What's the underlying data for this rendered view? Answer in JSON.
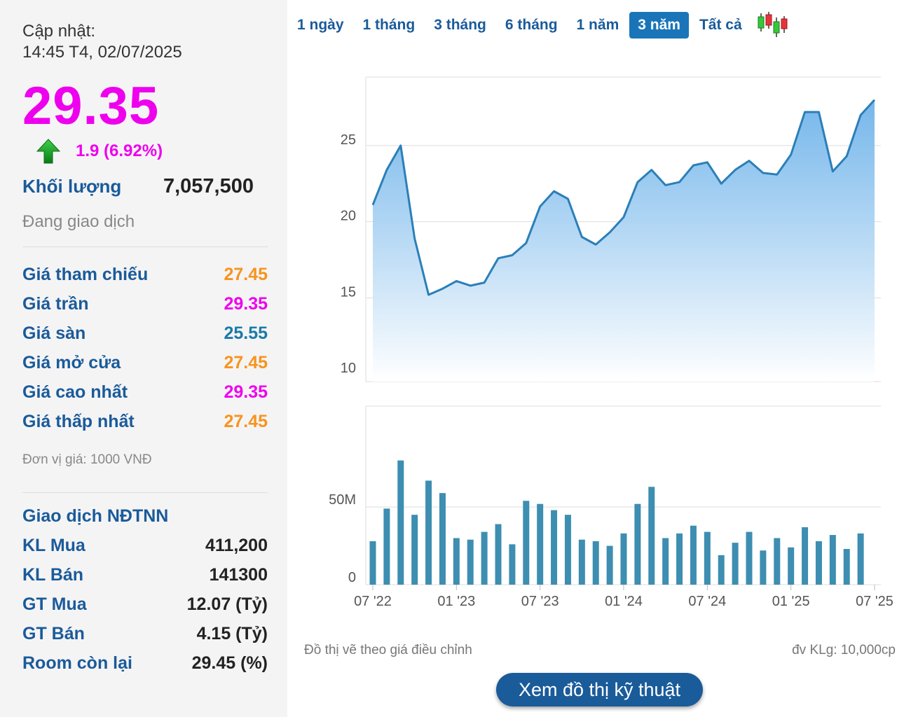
{
  "quote": {
    "update_label": "Cập nhật:",
    "update_time": "14:45 T4, 02/07/2025",
    "price": "29.35",
    "change": "1.9 (6.92%)",
    "volume_label": "Khối lượng",
    "volume_value": "7,057,500",
    "status": "Đang giao dịch",
    "unit_note": "Đơn vị giá: 1000 VNĐ"
  },
  "price_rows": [
    {
      "label": "Giá tham chiếu",
      "value": "27.45",
      "color": "#f7941d"
    },
    {
      "label": "Giá trần",
      "value": "29.35",
      "color": "#ee00ee"
    },
    {
      "label": "Giá sàn",
      "value": "25.55",
      "color": "#1a7aa8"
    },
    {
      "label": "Giá mở cửa",
      "value": "27.45",
      "color": "#f7941d"
    },
    {
      "label": "Giá cao nhất",
      "value": "29.35",
      "color": "#ee00ee"
    },
    {
      "label": "Giá thấp nhất",
      "value": "27.45",
      "color": "#f7941d"
    }
  ],
  "foreign": {
    "title": "Giao dịch NĐTNN",
    "rows": [
      {
        "label": "KL Mua",
        "value": "411,200"
      },
      {
        "label": "KL Bán",
        "value": "141300"
      },
      {
        "label": "GT Mua",
        "value": "12.07 (Tỷ)"
      },
      {
        "label": "GT Bán",
        "value": "4.15 (Tỷ)"
      },
      {
        "label": "Room còn lại",
        "value": "29.45 (%)"
      }
    ]
  },
  "tabs": [
    {
      "label": "1 ngày",
      "active": false
    },
    {
      "label": "1 tháng",
      "active": false
    },
    {
      "label": "3 tháng",
      "active": false
    },
    {
      "label": "6 tháng",
      "active": false
    },
    {
      "label": "1 năm",
      "active": false
    },
    {
      "label": "3 năm",
      "active": true
    },
    {
      "label": "Tất cả",
      "active": false
    }
  ],
  "chart_data": {
    "type": "area",
    "price_axis": {
      "ylim": [
        9.5,
        29.5
      ],
      "ticks": [
        "25",
        "20",
        "15",
        "10"
      ],
      "tick_values": [
        25,
        20,
        15,
        10
      ]
    },
    "volume_axis": {
      "ylim": [
        0,
        115
      ],
      "ticks": [
        "50M",
        "0"
      ],
      "tick_values": [
        50,
        0
      ]
    },
    "x_ticks": [
      {
        "label": "07 '22",
        "x": 0
      },
      {
        "label": "01 '23",
        "x": 6
      },
      {
        "label": "07 '23",
        "x": 12
      },
      {
        "label": "01 '24",
        "x": 18
      },
      {
        "label": "07 '24",
        "x": 24
      },
      {
        "label": "01 '25",
        "x": 30
      },
      {
        "label": "07 '25",
        "x": 36
      }
    ],
    "price": [
      21.1,
      23.4,
      25.0,
      18.9,
      15.2,
      15.6,
      16.1,
      15.8,
      16.0,
      17.6,
      17.8,
      18.6,
      21.0,
      22.0,
      21.5,
      19.0,
      18.5,
      19.3,
      20.3,
      22.6,
      23.4,
      22.4,
      22.6,
      23.7,
      23.9,
      22.5,
      23.4,
      24.0,
      23.2,
      23.1,
      24.4,
      27.2,
      27.2,
      23.3,
      24.3,
      27.0,
      28.0
    ],
    "volume": [
      28,
      49,
      80,
      45,
      67,
      59,
      30,
      29,
      34,
      39,
      26,
      54,
      52,
      48,
      45,
      29,
      28,
      25,
      33,
      52,
      63,
      30,
      33,
      38,
      34,
      19,
      27,
      34,
      22,
      30,
      24,
      37,
      28,
      32,
      23,
      33
    ],
    "colors": {
      "line": "#2b7fb8",
      "bar": "#3d8eb1",
      "grid": "#dddddd",
      "fill_top": "#6fb3ea",
      "fill_bottom": "#ffffff"
    }
  },
  "notes": {
    "left": "Đồ thị vẽ theo giá điều chỉnh",
    "right": "đv KLg: 10,000cp"
  },
  "tech_button": "Xem đồ thị kỹ thuật"
}
